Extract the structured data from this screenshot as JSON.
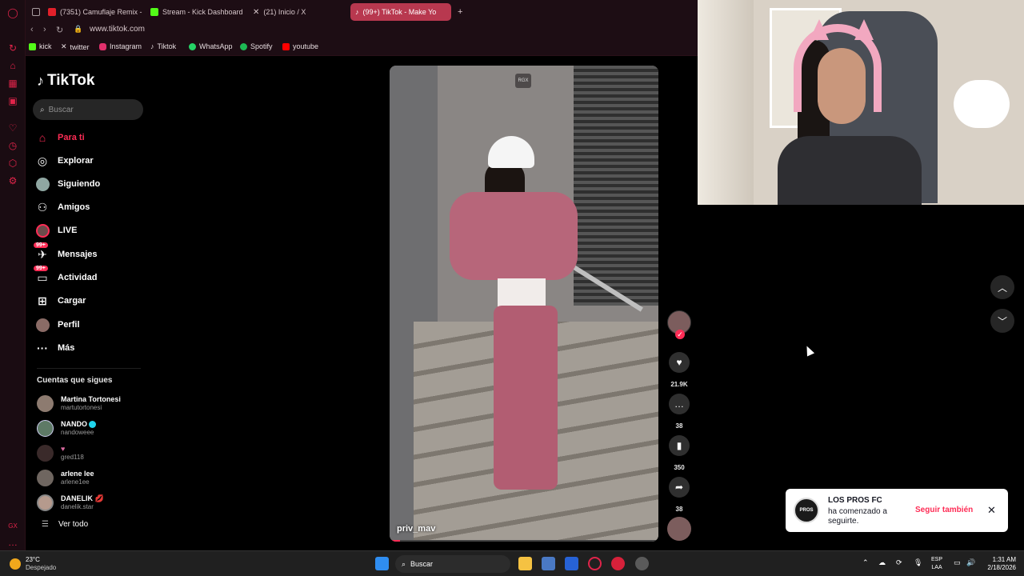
{
  "browser": {
    "tabs": [
      {
        "label": "(7351) Camuflaje Remix -",
        "color": "#e2202a"
      },
      {
        "label": "Stream - Kick Dashboard",
        "color": "#53fc18"
      },
      {
        "label": "(21) Inicio / X",
        "color": "#ffffff"
      },
      {
        "label": "(99+) TikTok - Make Yo",
        "color": "#ffffff"
      }
    ],
    "url": "www.tiktok.com",
    "bookmarks": [
      {
        "label": "kick",
        "color": "#53fc18"
      },
      {
        "label": "twitter",
        "color": "#ffffff"
      },
      {
        "label": "Instagram",
        "color": "#e1306c"
      },
      {
        "label": "Tiktok",
        "color": "#ffffff"
      },
      {
        "label": "WhatsApp",
        "color": "#25d366"
      },
      {
        "label": "Spotify",
        "color": "#1db954"
      },
      {
        "label": "youtube",
        "color": "#ff0000"
      }
    ]
  },
  "tiktok": {
    "logo_text": "TikTok",
    "search_placeholder": "Buscar",
    "nav": [
      {
        "label": "Para ti",
        "icon": "home-icon"
      },
      {
        "label": "Explorar",
        "icon": "compass-icon"
      },
      {
        "label": "Siguiendo",
        "icon": "avatar"
      },
      {
        "label": "Amigos",
        "icon": "friends-icon"
      },
      {
        "label": "LIVE",
        "icon": "avatar"
      },
      {
        "label": "Mensajes",
        "icon": "messages-icon",
        "badge": "99+"
      },
      {
        "label": "Actividad",
        "icon": "activity-icon",
        "badge": "99+"
      },
      {
        "label": "Cargar",
        "icon": "upload-icon"
      },
      {
        "label": "Perfil",
        "icon": "avatar"
      },
      {
        "label": "Más",
        "icon": "more-icon"
      }
    ],
    "following_title": "Cuentas que sigues",
    "following": [
      {
        "name": "Martina Tortonesi",
        "handle": "martutortonesi"
      },
      {
        "name": "NANDO",
        "handle": "nandoweee",
        "verified": true
      },
      {
        "name": "♥",
        "handle": "gred118"
      },
      {
        "name": "arlene lee",
        "handle": "arlene1ee"
      },
      {
        "name": "DANELIK 💋",
        "handle": "danelik.star"
      }
    ],
    "see_all": "Ver todo",
    "video": {
      "username": "priv_mav",
      "watermark": "RGX",
      "progress": 0.04
    },
    "actions": {
      "likes": "21.9K",
      "comments": "38",
      "saves": "350",
      "shares": "38"
    }
  },
  "toast": {
    "avatar_text": "PROS",
    "name": "LOS PROS FC",
    "message": "ha comenzado a seguirte.",
    "follow_back": "Seguir también"
  },
  "taskbar": {
    "temperature": "23°C",
    "weather": "Despejado",
    "search_placeholder": "Buscar",
    "language_1": "ESP",
    "language_2": "LAA",
    "time": "1:31 AM",
    "date": "2/18/2026"
  }
}
